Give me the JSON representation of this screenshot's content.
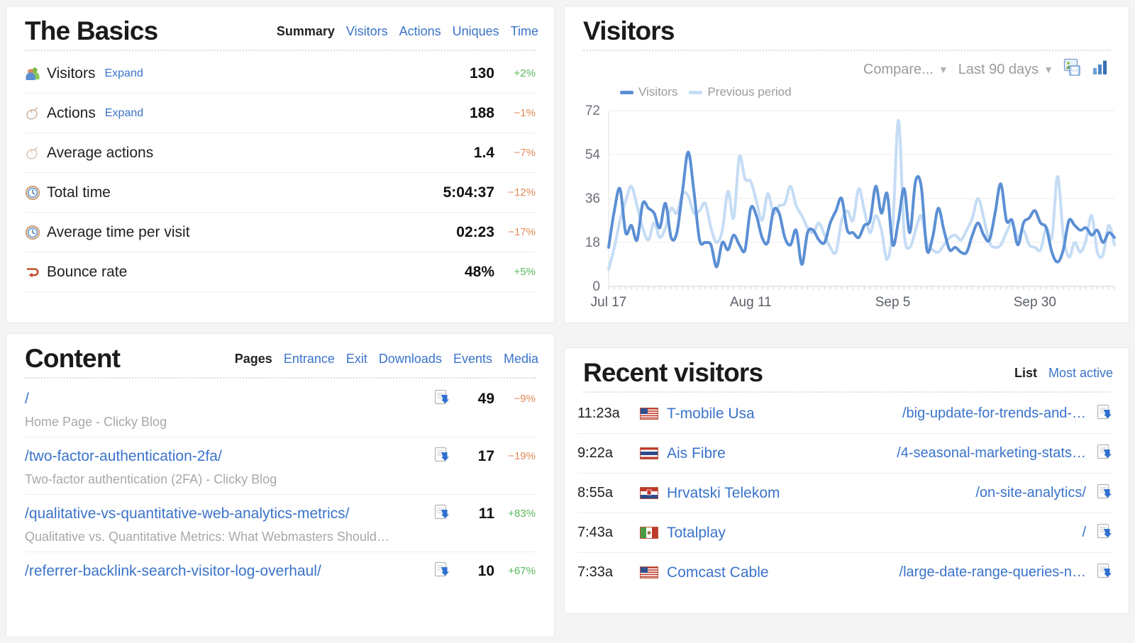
{
  "basics": {
    "title": "The Basics",
    "nav": [
      {
        "label": "Summary",
        "active": true
      },
      {
        "label": "Visitors",
        "active": false
      },
      {
        "label": "Actions",
        "active": false
      },
      {
        "label": "Uniques",
        "active": false
      },
      {
        "label": "Time",
        "active": false
      }
    ],
    "rows": [
      {
        "icon": "visitors-icon",
        "label": "Visitors",
        "expand": "Expand",
        "value": "130",
        "delta": "+2%",
        "dir": "up"
      },
      {
        "icon": "mouse-icon",
        "label": "Actions",
        "expand": "Expand",
        "value": "188",
        "delta": "−1%",
        "dir": "down"
      },
      {
        "icon": "mouse-icon",
        "label": "Average actions",
        "expand": "",
        "value": "1.4",
        "delta": "−7%",
        "dir": "down"
      },
      {
        "icon": "clock-icon",
        "label": "Total time",
        "expand": "",
        "value": "5:04:37",
        "delta": "−12%",
        "dir": "down"
      },
      {
        "icon": "clock-icon",
        "label": "Average time per visit",
        "expand": "",
        "value": "02:23",
        "delta": "−17%",
        "dir": "down"
      },
      {
        "icon": "bounce-icon",
        "label": "Bounce rate",
        "expand": "",
        "value": "48%",
        "delta": "+5%",
        "dir": "up"
      }
    ]
  },
  "content": {
    "title": "Content",
    "nav": [
      {
        "label": "Pages",
        "active": true
      },
      {
        "label": "Entrance",
        "active": false
      },
      {
        "label": "Exit",
        "active": false
      },
      {
        "label": "Downloads",
        "active": false
      },
      {
        "label": "Events",
        "active": false
      },
      {
        "label": "Media",
        "active": false
      }
    ],
    "rows": [
      {
        "url": "/",
        "subtitle": "Home Page - Clicky Blog",
        "count": "49",
        "delta": "−9%",
        "dir": "down"
      },
      {
        "url": "/two-factor-authentication-2fa/",
        "subtitle": "Two-factor authentication (2FA) - Clicky Blog",
        "count": "17",
        "delta": "−19%",
        "dir": "down"
      },
      {
        "url": "/qualitative-vs-quantitative-web-analytics-metrics/",
        "subtitle": "Qualitative vs. Quantitative Metrics: What Webmasters Should…",
        "count": "11",
        "delta": "+83%",
        "dir": "up"
      },
      {
        "url": "/referrer-backlink-search-visitor-log-overhaul/",
        "subtitle": "",
        "count": "10",
        "delta": "+67%",
        "dir": "up"
      }
    ]
  },
  "visitors": {
    "title": "Visitors",
    "toolbar": {
      "compare_label": "Compare...",
      "range_label": "Last 90 days",
      "export_icon": "export-image-icon",
      "chart_type_icon": "bar-chart-icon"
    }
  },
  "recent": {
    "title": "Recent visitors",
    "nav": [
      {
        "label": "List",
        "active": true
      },
      {
        "label": "Most active",
        "active": false
      }
    ],
    "rows": [
      {
        "time": "11:23a",
        "flag": "flag-us",
        "org": "T-mobile Usa",
        "path": "/big-update-for-trends-and-…"
      },
      {
        "time": "9:22a",
        "flag": "flag-th",
        "org": "Ais Fibre",
        "path": "/4-seasonal-marketing-stats…"
      },
      {
        "time": "8:55a",
        "flag": "flag-hr",
        "org": "Hrvatski Telekom",
        "path": "/on-site-analytics/"
      },
      {
        "time": "7:43a",
        "flag": "flag-mx",
        "org": "Totalplay",
        "path": "/"
      },
      {
        "time": "7:33a",
        "flag": "flag-us",
        "org": "Comcast Cable",
        "path": "/large-date-range-queries-n…"
      }
    ]
  },
  "colors": {
    "link": "#3a73c9",
    "positive": "#5bb85b",
    "negative": "#e08a5a",
    "series_current": "#5b8fd4",
    "series_previous": "#c5dcf5"
  },
  "chart_data": {
    "type": "line",
    "title": "Visitors",
    "xlabel": "",
    "ylabel": "",
    "ylim": [
      0,
      72
    ],
    "yticks": [
      0,
      18,
      36,
      54,
      72
    ],
    "grid": true,
    "legend_position": "top-left",
    "xticks": [
      "Jul 17",
      "Aug 11",
      "Sep 5",
      "Sep 30"
    ],
    "xtick_indices": [
      0,
      25,
      50,
      75
    ],
    "series": [
      {
        "name": "Visitors",
        "color": "#5b8fd4",
        "values": [
          16,
          31,
          40,
          22,
          25,
          19,
          34,
          32,
          30,
          24,
          34,
          20,
          22,
          39,
          55,
          39,
          19,
          18,
          17,
          8,
          18,
          15,
          21,
          17,
          15,
          32,
          29,
          20,
          18,
          31,
          30,
          20,
          17,
          23,
          9,
          22,
          23,
          19,
          18,
          26,
          31,
          36,
          23,
          22,
          20,
          25,
          27,
          41,
          30,
          38,
          17,
          27,
          40,
          22,
          43,
          41,
          15,
          20,
          32,
          23,
          15,
          16,
          14,
          14,
          21,
          26,
          21,
          19,
          30,
          42,
          27,
          27,
          17,
          26,
          28,
          31,
          26,
          24,
          14,
          10,
          15,
          27,
          25,
          23,
          24,
          21,
          23,
          18,
          22,
          20
        ]
      },
      {
        "name": "Previous period",
        "color": "#c5dcf5",
        "values": [
          7,
          16,
          27,
          35,
          41,
          33,
          24,
          19,
          26,
          20,
          24,
          32,
          30,
          38,
          37,
          30,
          31,
          34,
          24,
          18,
          23,
          39,
          28,
          53,
          44,
          43,
          35,
          27,
          38,
          30,
          33,
          34,
          41,
          33,
          29,
          24,
          22,
          26,
          21,
          16,
          14,
          27,
          31,
          27,
          40,
          31,
          22,
          29,
          23,
          11,
          25,
          68,
          22,
          16,
          23,
          29,
          18,
          15,
          14,
          17,
          20,
          21,
          19,
          23,
          28,
          36,
          28,
          18,
          16,
          17,
          22,
          26,
          20,
          23,
          17,
          16,
          15,
          24,
          20,
          45,
          21,
          12,
          18,
          14,
          19,
          29,
          14,
          13,
          25,
          17
        ]
      }
    ]
  }
}
